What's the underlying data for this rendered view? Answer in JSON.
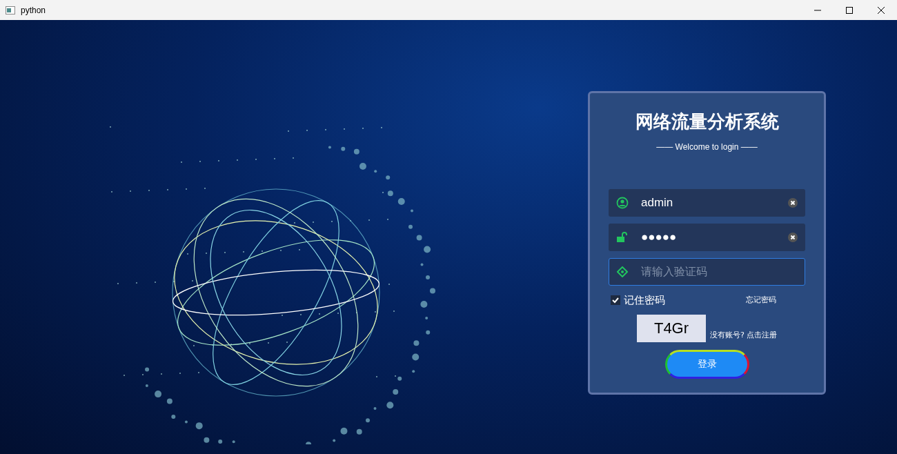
{
  "window": {
    "title": "python"
  },
  "login": {
    "title": "网络流量分析系统",
    "subtitle": "—— Welcome to login ——",
    "fields": [
      {
        "kind": "user",
        "value": "admin",
        "focused": false
      },
      {
        "kind": "password",
        "value": "●●●●●",
        "focused": false
      },
      {
        "kind": "captcha",
        "placeholder": "请输入验证码",
        "focused": true
      }
    ],
    "remember": {
      "label": "记住密码",
      "checked": true
    },
    "forgot": "忘记密码",
    "captcha_text": "T4Gr",
    "register": "没有账号? 点击注册",
    "submit": "登录"
  }
}
